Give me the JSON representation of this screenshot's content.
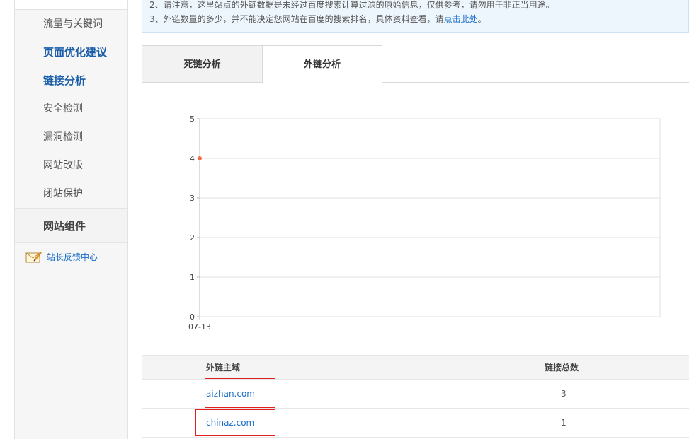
{
  "sidebar": {
    "items": [
      {
        "label": "流量与关键词",
        "active": false
      },
      {
        "label": "页面优化建议",
        "active": true
      },
      {
        "label": "链接分析",
        "active": true
      },
      {
        "label": "安全检测",
        "active": false
      },
      {
        "label": "漏洞检测",
        "active": false
      },
      {
        "label": "网站改版",
        "active": false
      },
      {
        "label": "闭站保护",
        "active": false
      }
    ],
    "group_label": "网站组件",
    "feedback_label": "站长反馈中心",
    "feedback_icon": "mail-pencil-icon"
  },
  "notice": {
    "line2": "2、请注意，这里站点的外链数据是未经过百度搜索计算过滤的原始信息，仅供参考，请勿用于非正当用途。",
    "line3_prefix": "3、外链数量的多少，并不能决定您网站在百度的搜索排名，具体资料查看，请",
    "line3_link": "点击此处",
    "line3_suffix": "。"
  },
  "tabs": [
    {
      "label": "死链分析",
      "active": false
    },
    {
      "label": "外链分析",
      "active": true
    }
  ],
  "chart_data": {
    "type": "line",
    "x": [
      "07-13"
    ],
    "series": [
      {
        "values": [
          4
        ]
      }
    ],
    "ylim": [
      0,
      5
    ],
    "yticks": [
      "0",
      "1",
      "2",
      "3",
      "4",
      "5"
    ],
    "grid": true,
    "colors": {
      "point": "#f26b4f",
      "grid": "#e2e2e2",
      "axis": "#bbbbbb"
    }
  },
  "table": {
    "headers": {
      "domain": "外链主域",
      "count": "链接总数"
    },
    "rows": [
      {
        "domain": "aizhan.com",
        "count": "3"
      },
      {
        "domain": "chinaz.com",
        "count": "1"
      }
    ]
  },
  "colors": {
    "link": "#1a6dc8",
    "active_nav": "#1a5ea8",
    "highlight": "#e02020"
  }
}
